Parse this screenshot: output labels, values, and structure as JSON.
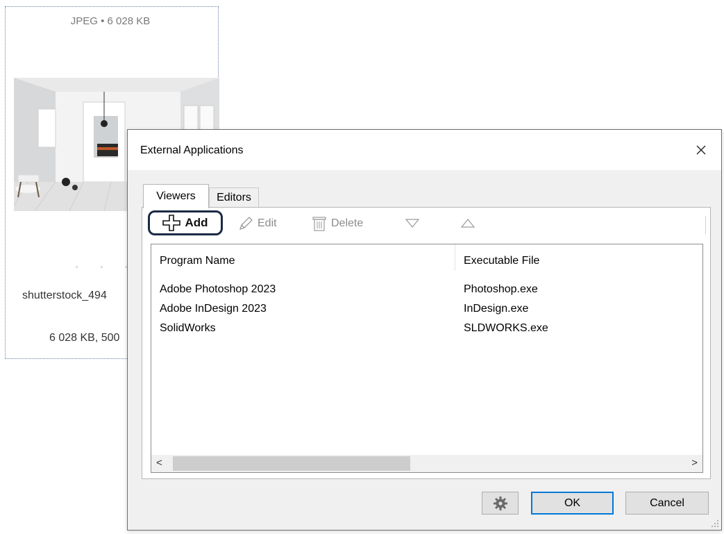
{
  "background_tile": {
    "format": "JPEG • 6 028 KB",
    "dots": "▫ ▫ ▫",
    "filename": "shutterstock_494",
    "details": "6 028 KB, 500"
  },
  "dialog": {
    "title": "External Applications",
    "close_glyph": "✕",
    "tabs": [
      {
        "label": "Viewers",
        "active": true
      },
      {
        "label": "Editors",
        "active": false
      }
    ],
    "toolbar": {
      "add_label": "Add",
      "edit_label": "Edit",
      "delete_label": "Delete",
      "move_down_icon": "triangle-down-icon",
      "move_up_icon": "triangle-up-icon"
    },
    "table": {
      "columns": [
        "Program Name",
        "Executable File"
      ],
      "rows": [
        {
          "program": "Adobe Photoshop 2023",
          "exe": "Photoshop.exe"
        },
        {
          "program": "Adobe InDesign 2023",
          "exe": "InDesign.exe"
        },
        {
          "program": "SolidWorks",
          "exe": "SLDWORKS.exe"
        }
      ],
      "scroll_left": "<",
      "scroll_right": ">"
    },
    "buttons": {
      "settings_icon": "gear-icon",
      "ok_label": "OK",
      "cancel_label": "Cancel"
    }
  },
  "colors": {
    "highlight_outline": "#1b2a44",
    "default_button_border": "#0078d7"
  }
}
